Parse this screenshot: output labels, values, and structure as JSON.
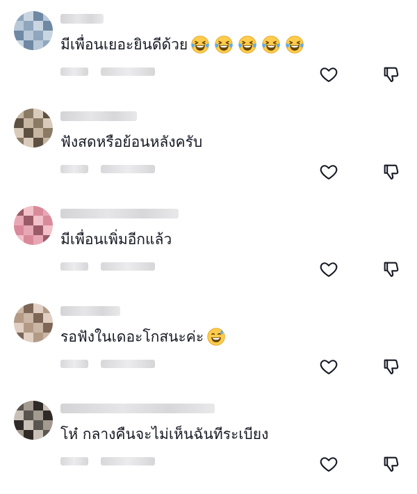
{
  "comments": [
    {
      "text": "มีเพื่อนเยอะยินดีด้วย",
      "emoji": [
        "laughing-tears",
        "laughing-tears",
        "laughing-tears",
        "laughing-tears",
        "laughing-tears"
      ],
      "avatar_colors": [
        "#8fa6bd",
        "#b8c8d8",
        "#6f88a3",
        "#c9d6e2"
      ]
    },
    {
      "text": "ฟังสดหรือย้อนหลังครับ",
      "emoji": [],
      "avatar_colors": [
        "#8a7a66",
        "#c7b6a2",
        "#5e5142",
        "#d9cbbb"
      ]
    },
    {
      "text": "มีเพื่อนเพิ่มอีกแล้ว",
      "emoji": [],
      "avatar_colors": [
        "#d98a9a",
        "#f2c0c8",
        "#9b5a67",
        "#e8a7b5"
      ]
    },
    {
      "text": "รอฟังในเดอะโกสนะค่ะ",
      "emoji": [
        "sweat-smile"
      ],
      "avatar_colors": [
        "#b39a86",
        "#e0cfc2",
        "#7d6656",
        "#cbb5a4"
      ]
    },
    {
      "text": "โห๋ กลางคืนจะไม่เห็นฉันทีระเบียง",
      "emoji": [],
      "avatar_colors": [
        "#5b5550",
        "#c9c1b8",
        "#2f2a27",
        "#a39a90"
      ]
    }
  ]
}
